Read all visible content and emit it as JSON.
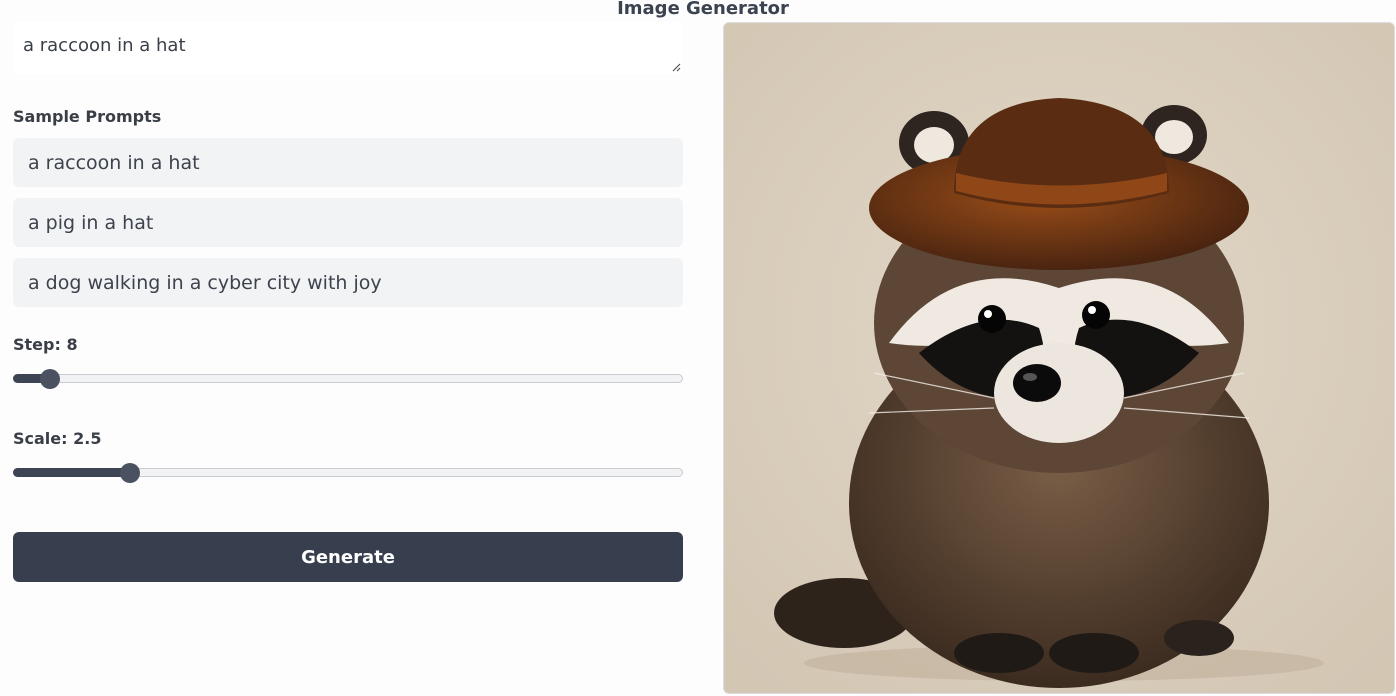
{
  "header": {
    "title": "Image Generator"
  },
  "prompt": {
    "value": "a raccoon in a hat"
  },
  "sample_prompts": {
    "label": "Sample Prompts",
    "items": [
      "a raccoon in a hat",
      "a pig in a hat",
      "a dog walking in a cyber city with joy"
    ]
  },
  "step": {
    "label": "Step: 8",
    "value": 8,
    "fill_fraction": 0.055
  },
  "scale": {
    "label": "Scale: 2.5",
    "value": 2.5,
    "fill_fraction": 0.175
  },
  "generate": {
    "label": "Generate"
  },
  "colors": {
    "button": "#373f4f",
    "sample_bg": "#f2f3f5",
    "slider": "#4a5262"
  },
  "output_image": {
    "subject": "raccoon wearing a brown felt hat"
  }
}
